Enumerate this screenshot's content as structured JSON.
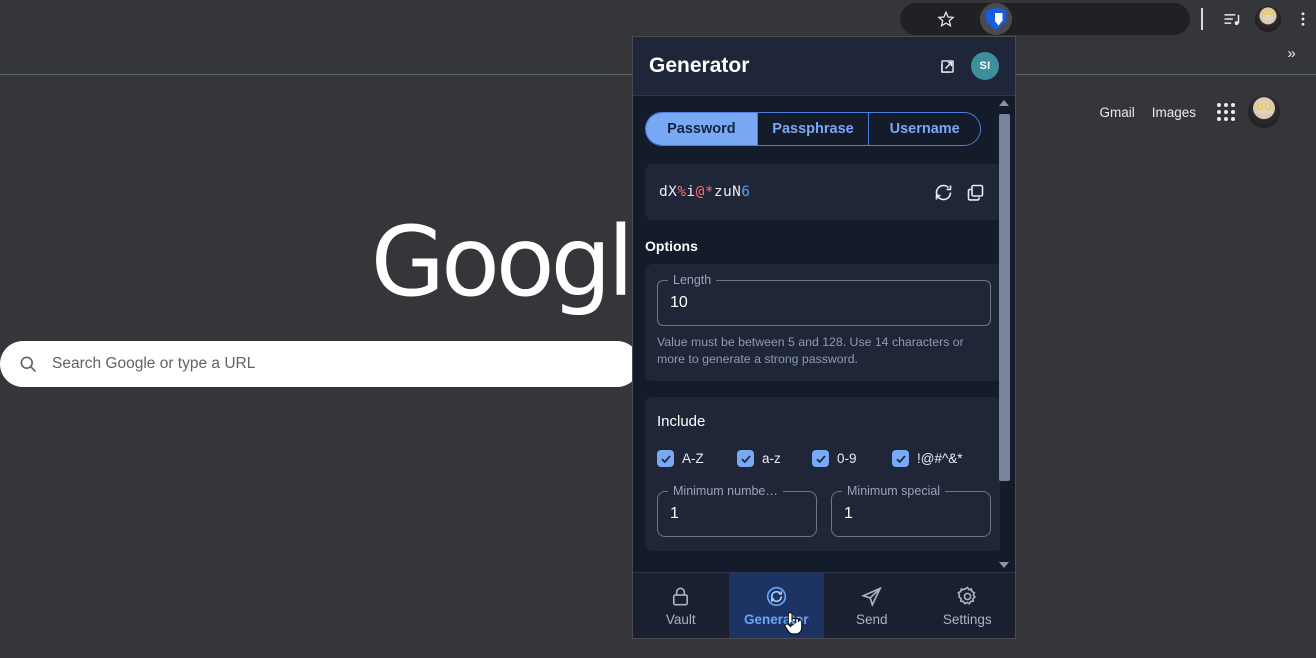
{
  "browser": {
    "omnibox_value": "",
    "star_icon": "star-icon",
    "extension_icon": "bitwarden-shield-icon",
    "media_icon": "media-control-icon",
    "profile_icon": "profile-avatar-icon",
    "menu_icon": "three-dot-menu-icon",
    "bookmarks_overflow": "»"
  },
  "google_page": {
    "links": [
      {
        "label": "Gmail"
      },
      {
        "label": "Images"
      }
    ],
    "apps_icon": "google-apps-grid-icon",
    "account_avatar": "google-account-avatar",
    "logo_text": "Google",
    "search": {
      "placeholder": "Search Google or type a URL",
      "value": "",
      "icon": "search-icon"
    }
  },
  "popup": {
    "header": {
      "title": "Generator",
      "popout_icon": "popout-window-icon",
      "avatar_initials": "SI"
    },
    "tabs": [
      {
        "label": "Password",
        "active": true
      },
      {
        "label": "Passphrase",
        "active": false
      },
      {
        "label": "Username",
        "active": false
      }
    ],
    "generated": {
      "chars": [
        {
          "c": "d",
          "type": "default"
        },
        {
          "c": "X",
          "type": "default"
        },
        {
          "c": "%",
          "type": "special"
        },
        {
          "c": "i",
          "type": "default"
        },
        {
          "c": "@",
          "type": "special"
        },
        {
          "c": "*",
          "type": "special"
        },
        {
          "c": "z",
          "type": "default"
        },
        {
          "c": "u",
          "type": "default"
        },
        {
          "c": "N",
          "type": "default"
        },
        {
          "c": "6",
          "type": "number"
        }
      ],
      "plain": "dX%i@*zuN6",
      "regenerate_icon": "regenerate-icon",
      "copy_icon": "copy-icon"
    },
    "options": {
      "title": "Options",
      "length_label": "Length",
      "length_value": "10",
      "helper_text": "Value must be between 5 and 128. Use 14 characters or more to generate a strong password."
    },
    "include": {
      "title": "Include",
      "checkboxes": [
        {
          "label": "A-Z",
          "checked": true
        },
        {
          "label": "a-z",
          "checked": true
        },
        {
          "label": "0-9",
          "checked": true
        },
        {
          "label": "!@#^&*",
          "checked": true
        }
      ],
      "min_number_label": "Minimum numbe…",
      "min_number_value": "1",
      "min_special_label": "Minimum special",
      "min_special_value": "1"
    },
    "bottom_nav": [
      {
        "label": "Vault",
        "icon": "lock-icon",
        "active": false
      },
      {
        "label": "Generator",
        "icon": "refresh-circle-icon",
        "active": true
      },
      {
        "label": "Send",
        "icon": "paper-plane-icon",
        "active": false
      },
      {
        "label": "Settings",
        "icon": "gear-icon",
        "active": false
      }
    ]
  },
  "colors": {
    "accent_blue": "#79a8f5",
    "active_nav_bg": "#1d3363",
    "popup_bg": "#141b2b",
    "card_bg": "#1f2638",
    "special_char": "#ff6b6b",
    "number_char": "#5a9bf0",
    "avatar_bg": "#3e8f9e"
  }
}
